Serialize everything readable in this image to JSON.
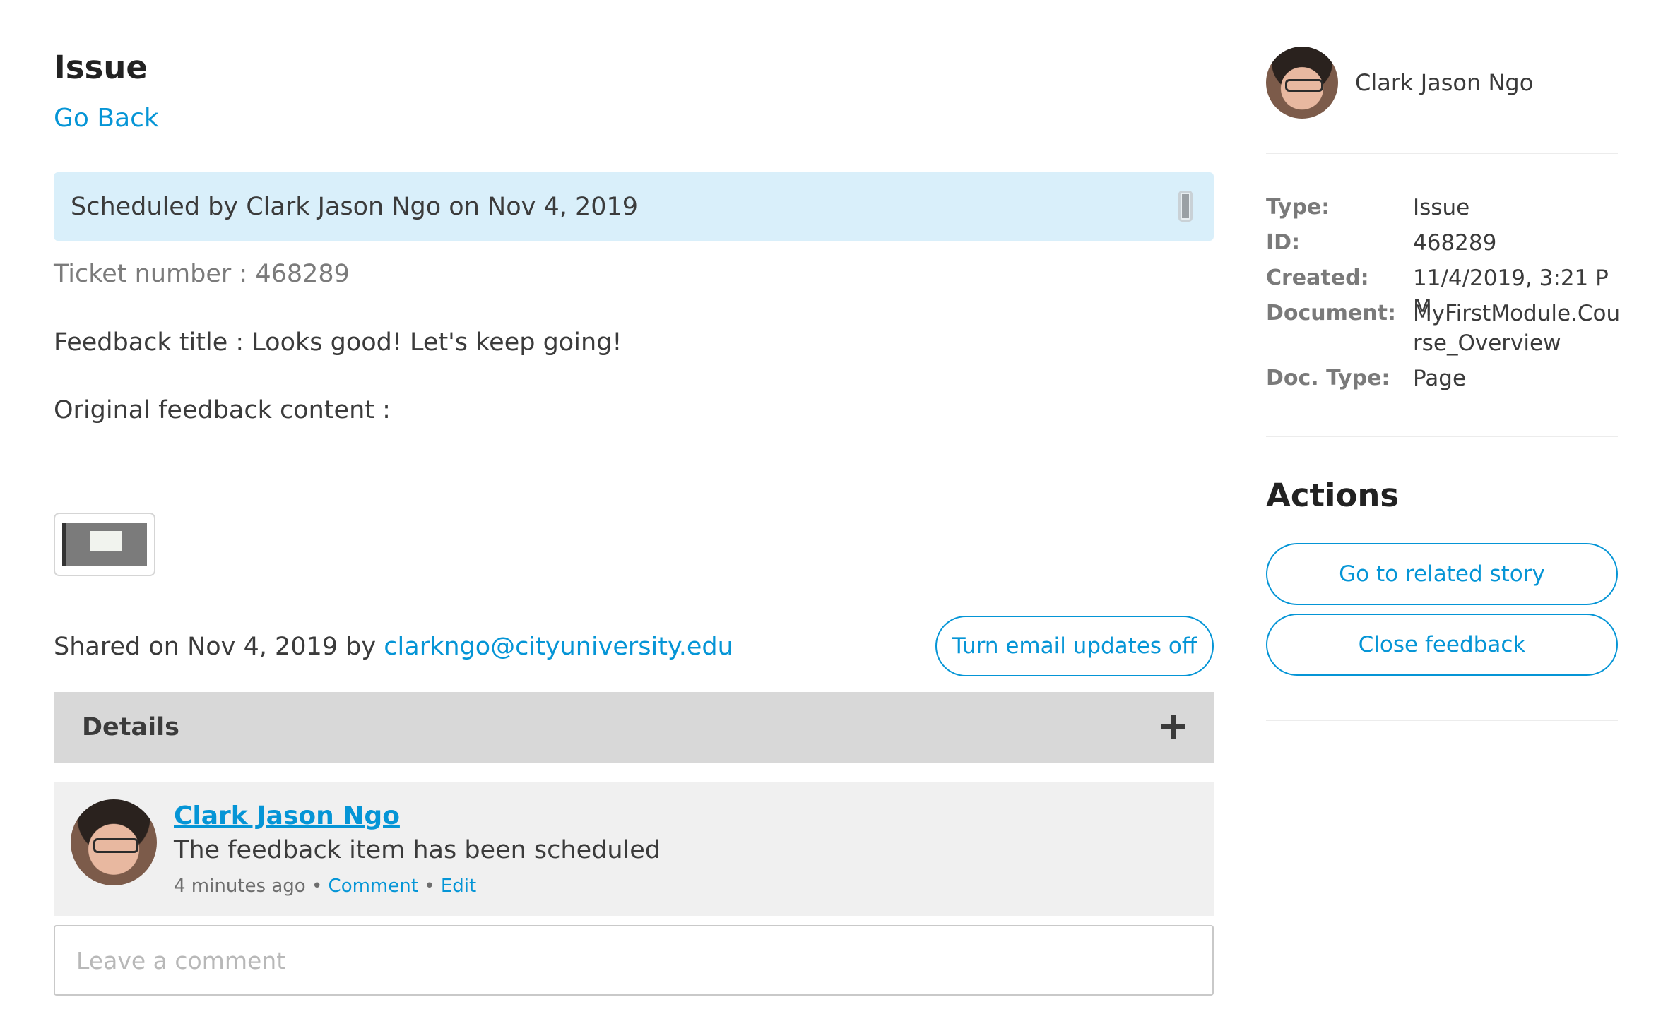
{
  "page": {
    "title": "Issue",
    "go_back": "Go Back"
  },
  "status": {
    "text": "Scheduled by Clark Jason Ngo on Nov 4, 2019"
  },
  "ticket": {
    "line": "Ticket number : 468289",
    "feedback_title": "Feedback title : Looks good! Let's keep going!",
    "original_label": "Original feedback content :"
  },
  "shared": {
    "prefix": "Shared on Nov 4, 2019 by",
    "email": "clarkngo@cityuniversity.edu",
    "email_updates_button": "Turn email updates off"
  },
  "details": {
    "label": "Details"
  },
  "comment": {
    "author": "Clark Jason Ngo",
    "body": "The feedback item has been scheduled",
    "time": "4 minutes ago",
    "separator": "•",
    "comment_link": "Comment",
    "edit_link": "Edit"
  },
  "comment_input": {
    "placeholder": "Leave a comment"
  },
  "sidebar": {
    "user_name": "Clark Jason Ngo",
    "meta": [
      {
        "key": "Type:",
        "value": "Issue"
      },
      {
        "key": "ID:",
        "value": "468289"
      },
      {
        "key": "Created:",
        "value": "11/4/2019, 3:21 PM"
      },
      {
        "key": "Document:",
        "value": "MyFirstModule.Course_Overview"
      },
      {
        "key": "Doc. Type:",
        "value": "Page"
      }
    ],
    "actions_title": "Actions",
    "actions": [
      {
        "label": "Go to related story"
      },
      {
        "label": "Close feedback"
      }
    ]
  },
  "colors": {
    "accent": "#0595d6",
    "banner": "#d9effa",
    "details_bar": "#d8d8d8",
    "comment_card": "#f0f0f0"
  }
}
